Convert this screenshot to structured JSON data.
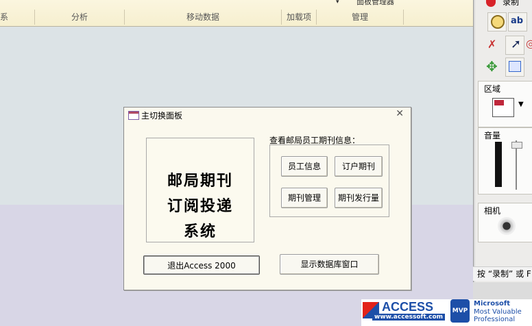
{
  "ribbon": {
    "groups": [
      "系",
      "分析",
      "移动数据",
      "加载项",
      "管理"
    ],
    "top_fragment": "面板管理器"
  },
  "dialog": {
    "title": "主切换面板",
    "banner_lines": [
      "邮局期刊",
      "订阅投递",
      "系统"
    ],
    "caption": "查看邮局员工期刊信息：",
    "buttons": {
      "employee_info": "员工信息",
      "subscriber_journal": "订户期刊",
      "journal_management": "期刊管理",
      "journal_circulation": "期刊发行量",
      "exit": "退出Access 2000",
      "show_db": "显示数据库窗口"
    }
  },
  "toolbox": {
    "record_label": "录制",
    "region_label": "区域",
    "volume_label": "音量",
    "camera_label": "相机",
    "status_text": "按 “录制” 或 F"
  },
  "logos": {
    "access_name": "ACCESS",
    "access_url": "www.accessoft.com",
    "ms_line1": "Microsoft",
    "ms_line2": "Most Valuable",
    "ms_line3": "Professional",
    "mvp": "MVP"
  }
}
